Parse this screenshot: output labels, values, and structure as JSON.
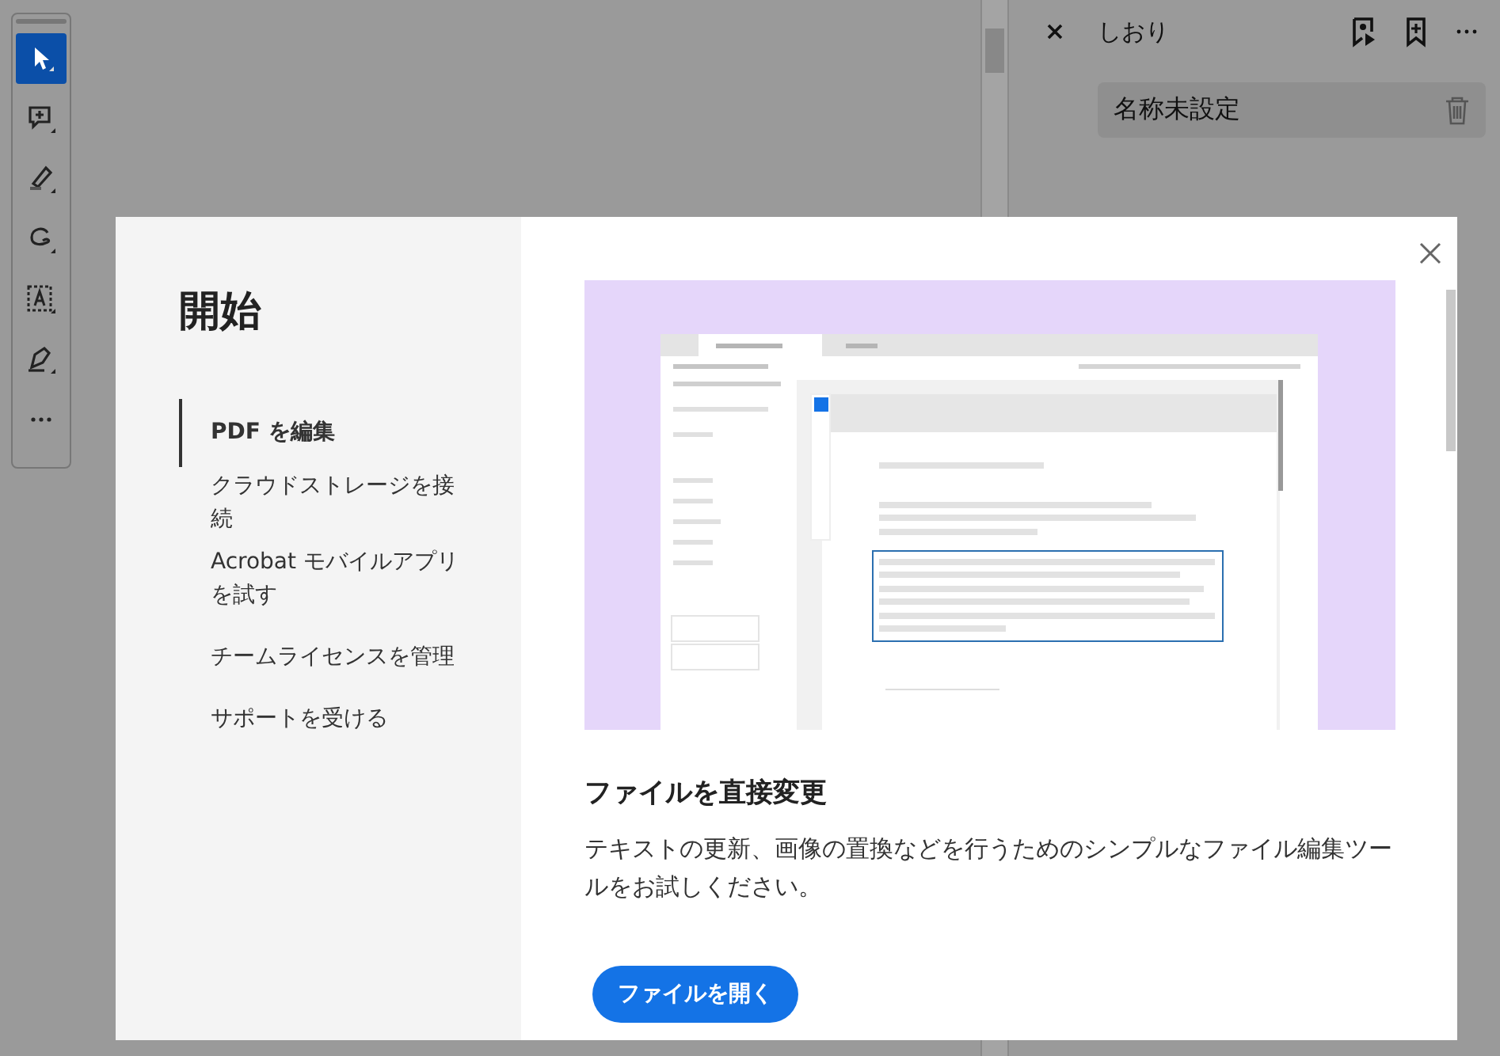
{
  "toolbar": {
    "tools": [
      {
        "kind": "select",
        "selected": true
      },
      {
        "kind": "comment",
        "selected": false
      },
      {
        "kind": "highlight",
        "selected": false
      },
      {
        "kind": "draw",
        "selected": false
      },
      {
        "kind": "text",
        "selected": false
      },
      {
        "kind": "sign",
        "selected": false
      },
      {
        "kind": "more",
        "selected": false
      }
    ]
  },
  "bookmarks_panel": {
    "title": "しおり",
    "items": [
      {
        "label": "名称未設定"
      }
    ]
  },
  "dialog": {
    "title": "開始",
    "nav": [
      {
        "label": "PDF を編集",
        "selected": true
      },
      {
        "label": "クラウドストレージを接続",
        "selected": false
      },
      {
        "label": "Acrobat モバイルアプリを試す",
        "selected": false
      },
      {
        "label": "チームライセンスを管理",
        "selected": false
      },
      {
        "label": "サポートを受ける",
        "selected": false
      }
    ],
    "heading": "ファイルを直接変更",
    "description": "テキストの更新、画像の置換などを行うためのシンプルなファイル編集ツールをお試しください。",
    "button": "ファイルを開く"
  }
}
